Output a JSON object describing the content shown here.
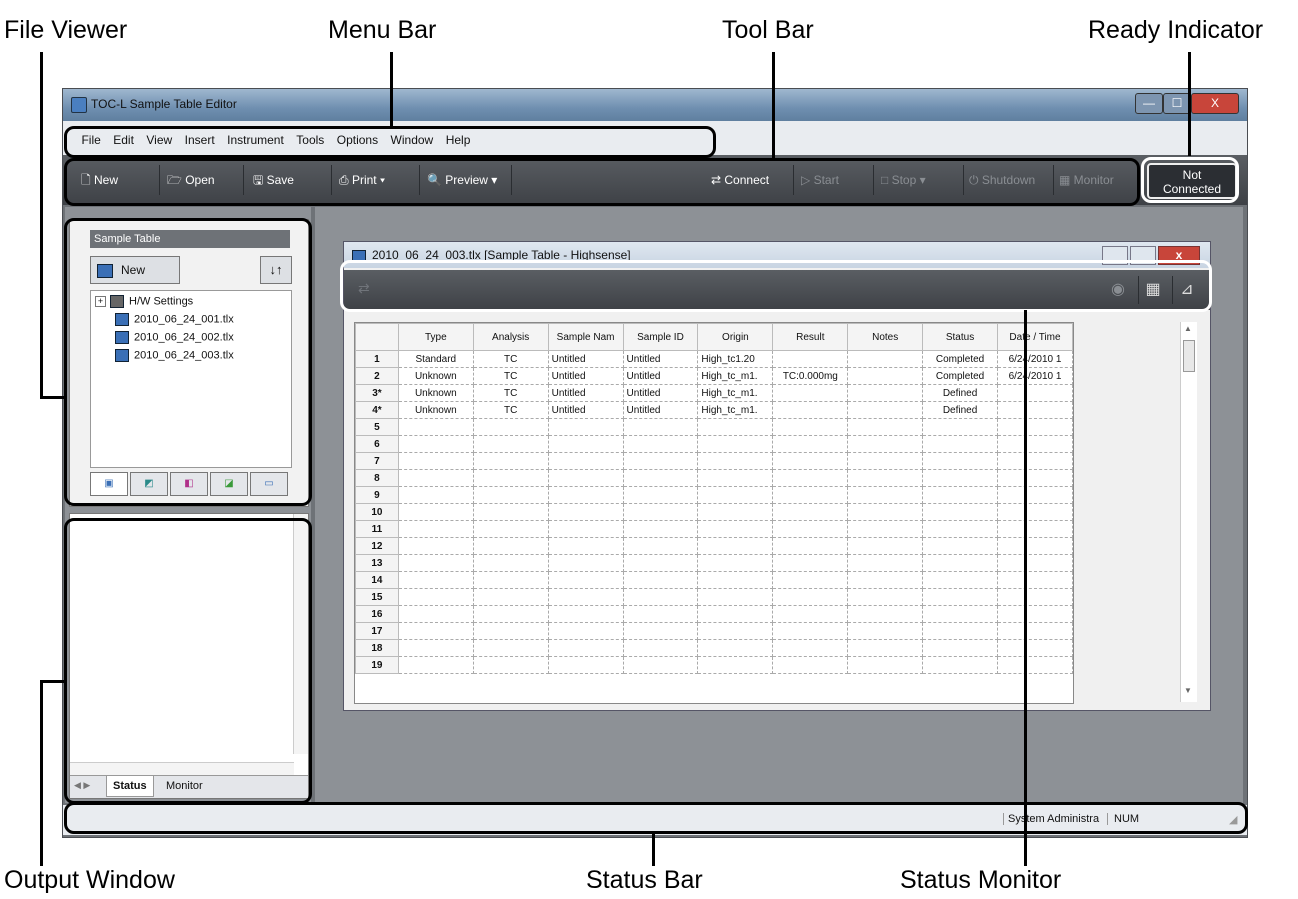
{
  "callouts": {
    "file_viewer": "File Viewer",
    "menu_bar": "Menu Bar",
    "tool_bar": "Tool Bar",
    "ready_indicator": "Ready Indicator",
    "output_window": "Output Window",
    "status_bar": "Status Bar",
    "status_monitor": "Status Monitor"
  },
  "window": {
    "title": "TOC-L Sample Table Editor",
    "minimize": "—",
    "maximize": "☐",
    "close": "X"
  },
  "menu": [
    "File",
    "Edit",
    "View",
    "Insert",
    "Instrument",
    "Tools",
    "Options",
    "Window",
    "Help"
  ],
  "toolbar": {
    "new": "New",
    "open": "Open",
    "save": "Save",
    "print": "Print",
    "preview": "Preview",
    "connect": "Connect",
    "start": "Start",
    "stop": "Stop",
    "shutdown": "Shutdown",
    "monitor": "Monitor"
  },
  "ready_indicator": {
    "line1": "Not",
    "line2": "Connected"
  },
  "file_viewer": {
    "header": "Sample Table",
    "new_button": "New",
    "tree": [
      "H/W Settings",
      "2010_06_24_001.tlx",
      "2010_06_24_002.tlx",
      "2010_06_24_003.tlx"
    ]
  },
  "output_window": {
    "tabs": [
      "Status",
      "Monitor"
    ]
  },
  "child_window": {
    "title": "2010_06_24_003.tlx [Sample Table - Highsense]"
  },
  "table": {
    "columns": [
      "Type",
      "Analysis",
      "Sample Nam",
      "Sample ID",
      "Origin",
      "Result",
      "Notes",
      "Status",
      "Date / Time"
    ],
    "rows": [
      {
        "num": "1",
        "cells": [
          "Standard",
          "TC",
          "Untitled",
          "Untitled",
          "High_tc1.20",
          "",
          "",
          "Completed",
          "6/24/2010 1"
        ]
      },
      {
        "num": "2",
        "cells": [
          "Unknown",
          "TC",
          "Untitled",
          "Untitled",
          "High_tc_m1.",
          "TC:0.000mg",
          "",
          "Completed",
          "6/24/2010 1"
        ]
      },
      {
        "num": "3*",
        "cells": [
          "Unknown",
          "TC",
          "Untitled",
          "Untitled",
          "High_tc_m1.",
          "",
          "",
          "Defined",
          ""
        ]
      },
      {
        "num": "4*",
        "cells": [
          "Unknown",
          "TC",
          "Untitled",
          "Untitled",
          "High_tc_m1.",
          "",
          "",
          "Defined",
          ""
        ]
      },
      {
        "num": "5",
        "cells": [
          "",
          "",
          "",
          "",
          "",
          "",
          "",
          "",
          ""
        ]
      },
      {
        "num": "6",
        "cells": [
          "",
          "",
          "",
          "",
          "",
          "",
          "",
          "",
          ""
        ]
      },
      {
        "num": "7",
        "cells": [
          "",
          "",
          "",
          "",
          "",
          "",
          "",
          "",
          ""
        ]
      },
      {
        "num": "8",
        "cells": [
          "",
          "",
          "",
          "",
          "",
          "",
          "",
          "",
          ""
        ]
      },
      {
        "num": "9",
        "cells": [
          "",
          "",
          "",
          "",
          "",
          "",
          "",
          "",
          ""
        ]
      },
      {
        "num": "10",
        "cells": [
          "",
          "",
          "",
          "",
          "",
          "",
          "",
          "",
          ""
        ]
      },
      {
        "num": "11",
        "cells": [
          "",
          "",
          "",
          "",
          "",
          "",
          "",
          "",
          ""
        ]
      },
      {
        "num": "12",
        "cells": [
          "",
          "",
          "",
          "",
          "",
          "",
          "",
          "",
          ""
        ]
      },
      {
        "num": "13",
        "cells": [
          "",
          "",
          "",
          "",
          "",
          "",
          "",
          "",
          ""
        ]
      },
      {
        "num": "14",
        "cells": [
          "",
          "",
          "",
          "",
          "",
          "",
          "",
          "",
          ""
        ]
      },
      {
        "num": "15",
        "cells": [
          "",
          "",
          "",
          "",
          "",
          "",
          "",
          "",
          ""
        ]
      },
      {
        "num": "16",
        "cells": [
          "",
          "",
          "",
          "",
          "",
          "",
          "",
          "",
          ""
        ]
      },
      {
        "num": "17",
        "cells": [
          "",
          "",
          "",
          "",
          "",
          "",
          "",
          "",
          ""
        ]
      },
      {
        "num": "18",
        "cells": [
          "",
          "",
          "",
          "",
          "",
          "",
          "",
          "",
          ""
        ]
      },
      {
        "num": "19",
        "cells": [
          "",
          "",
          "",
          "",
          "",
          "",
          "",
          "",
          ""
        ]
      }
    ]
  },
  "status_bar": {
    "user": "System Administra",
    "num": "NUM"
  },
  "colors": {
    "toolbar": "#3e4146",
    "workspace": "#8d9196",
    "titlebar": "#6f8fb0"
  }
}
